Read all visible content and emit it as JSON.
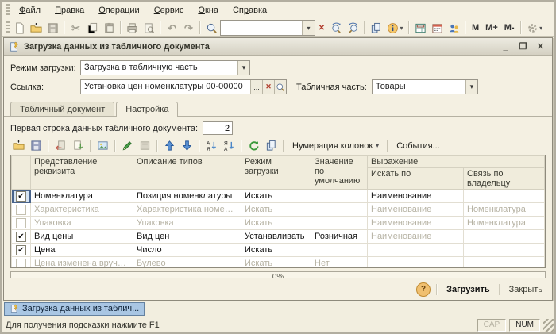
{
  "colors": {
    "app_bg": "#f2eedf",
    "selection_blue": "#a9c6e3",
    "accent_folder": "#f3cf72",
    "muted_text": "#b6b2a3"
  },
  "glyphs": {
    "dropdown": "▾",
    "clear": "✕",
    "ellipsis": "...",
    "undo": "↶",
    "redo": "↷",
    "cut": "✂",
    "check": "✔",
    "refresh": "↻",
    "minimize": "_",
    "maximize": "❐",
    "close": "✕",
    "help": "?"
  },
  "menubar": {
    "items": [
      {
        "label": "Файл",
        "u": 0
      },
      {
        "label": "Правка",
        "u": 0
      },
      {
        "label": "Операции",
        "u": 0
      },
      {
        "label": "Сервис",
        "u": 0
      },
      {
        "label": "Окна",
        "u": 0
      },
      {
        "label": "Справка",
        "u": 2
      }
    ]
  },
  "toolbar": {
    "search_value": "",
    "memory": [
      "M",
      "M+",
      "M-"
    ]
  },
  "window": {
    "title": "Загрузка данных из табличного документа",
    "form": {
      "mode_label": "Режим загрузки:",
      "mode_value": "Загрузка в табличную часть",
      "link_label": "Ссылка:",
      "link_value": "Установка цен номенклатуры 00-00000",
      "tabular_label": "Табличная часть:",
      "tabular_value": "Товары"
    },
    "tabs": [
      {
        "label": "Табличный документ"
      },
      {
        "label": "Настройка"
      }
    ],
    "settings": {
      "first_row_label": "Первая строка данных табличного документа:",
      "first_row_value": "2",
      "numbering_label": "Нумерация колонок",
      "events_label": "События..."
    },
    "table": {
      "headers": {
        "attr": "Представление реквизита",
        "types": "Описание типов",
        "mode": "Режим загрузки",
        "default": "Значение по умолчанию",
        "group": "Выражение",
        "search_by": "Искать по",
        "owner_link": "Связь по владельцу"
      },
      "rows": [
        {
          "checked": true,
          "muted": false,
          "current": true,
          "cells": [
            "Номенклатура",
            "Позиция номенклатуры",
            "Искать",
            "",
            "Наименование",
            ""
          ]
        },
        {
          "checked": false,
          "muted": true,
          "cells": [
            "Характеристика",
            "Характеристика номенклатуры",
            "Искать",
            "",
            "Наименование",
            "Номенклатура"
          ]
        },
        {
          "checked": false,
          "muted": true,
          "cells": [
            "Упаковка",
            "Упаковка",
            "Искать",
            "",
            "Наименование",
            "Номенклатура"
          ]
        },
        {
          "checked": true,
          "muted": false,
          "cell4_muted": true,
          "cells": [
            "Вид цены",
            "Вид цен",
            "Устанавливать",
            "Розничная",
            "Наименование",
            ""
          ]
        },
        {
          "checked": true,
          "muted": false,
          "cells": [
            "Цена",
            "Число",
            "Искать",
            "",
            "",
            ""
          ]
        },
        {
          "checked": false,
          "muted": true,
          "cells": [
            "Цена изменена вручную",
            "Булево",
            "Искать",
            "Нет",
            "",
            ""
          ]
        }
      ]
    },
    "progress": {
      "value": "0%"
    },
    "footer": {
      "load": "Загрузить",
      "close": "Закрыть"
    }
  },
  "taskbar": {
    "items": [
      {
        "label": "Загрузка данных из таблич..."
      }
    ]
  },
  "statusbar": {
    "hint": "Для получения подсказки нажмите F1",
    "cap": "CAP",
    "num": "NUM"
  }
}
